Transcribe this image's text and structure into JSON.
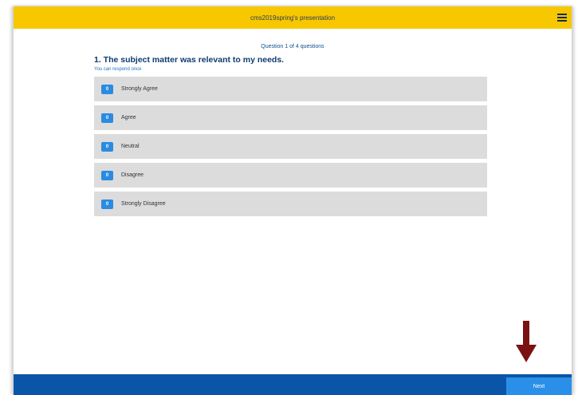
{
  "header": {
    "title": "cms2019spring's presentation",
    "menu_icon": "hamburger-menu-icon"
  },
  "progress": {
    "text": "Question 1 of 4 questions"
  },
  "question": {
    "title": "1. The subject matter was relevant to my needs.",
    "hint": "You can respond once"
  },
  "options": [
    {
      "count": "0",
      "label": "Strongly Agree"
    },
    {
      "count": "0",
      "label": "Agree"
    },
    {
      "count": "0",
      "label": "Neutral"
    },
    {
      "count": "0",
      "label": "Disagree"
    },
    {
      "count": "0",
      "label": "Strongly Disagree"
    }
  ],
  "footer": {
    "next_label": "Next"
  },
  "annotation": {
    "arrow_icon": "down-arrow-icon",
    "arrow_color": "#7a1212"
  },
  "colors": {
    "header_bg": "#f7c800",
    "footer_bg": "#0a55a8",
    "accent": "#2a8be0",
    "option_bg": "#dcdcdc"
  }
}
